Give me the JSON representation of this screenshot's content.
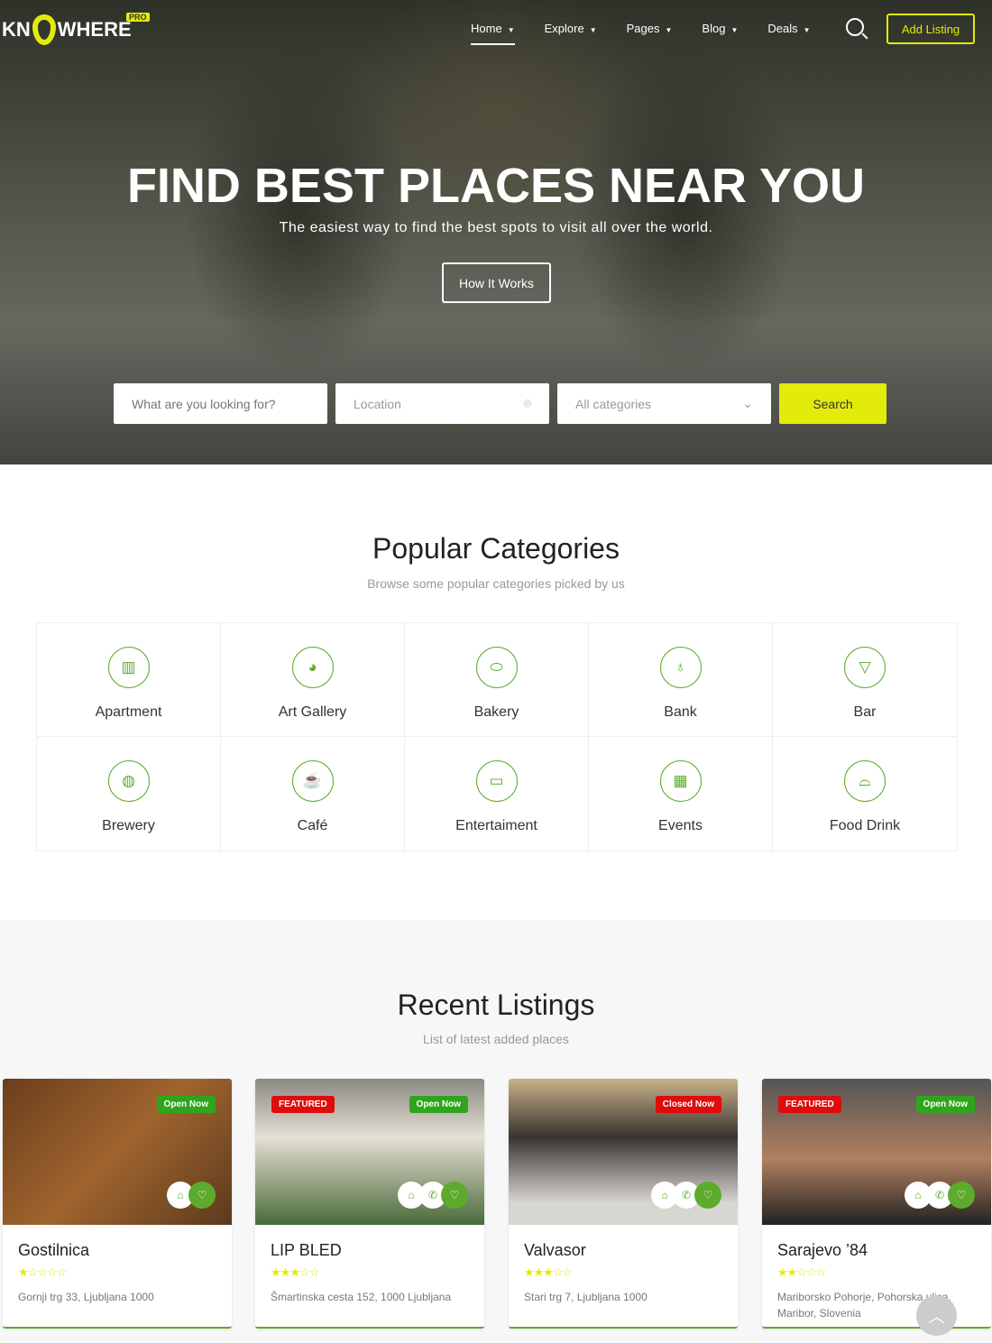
{
  "brand": {
    "logo_left": "KN",
    "logo_right": "WHERE",
    "badge": "PRO"
  },
  "nav": {
    "items": [
      {
        "label": "Home",
        "active": true
      },
      {
        "label": "Explore"
      },
      {
        "label": "Pages"
      },
      {
        "label": "Blog"
      },
      {
        "label": "Deals"
      }
    ],
    "add_listing": "Add Listing"
  },
  "hero": {
    "title": "FIND BEST PLACES NEAR YOU",
    "subtitle": "The easiest way to find the best spots to visit all over the world.",
    "cta": "How It Works"
  },
  "search": {
    "keyword_placeholder": "What are you looking for?",
    "location_placeholder": "Location",
    "category_value": "All categories",
    "button": "Search"
  },
  "categories": {
    "title": "Popular Categories",
    "subtitle": "Browse some popular categories picked by us",
    "items": [
      {
        "label": "Apartment",
        "icon": "building-icon"
      },
      {
        "label": "Art Gallery",
        "icon": "palette-icon"
      },
      {
        "label": "Bakery",
        "icon": "bread-icon"
      },
      {
        "label": "Bank",
        "icon": "money-bag-icon"
      },
      {
        "label": "Bar",
        "icon": "wine-glass-icon"
      },
      {
        "label": "Brewery",
        "icon": "beer-icon"
      },
      {
        "label": "Café",
        "icon": "coffee-icon"
      },
      {
        "label": "Entertaiment",
        "icon": "vr-glasses-icon"
      },
      {
        "label": "Events",
        "icon": "calendar-icon"
      },
      {
        "label": "Food Drink",
        "icon": "cloche-icon"
      }
    ]
  },
  "listings": {
    "title": "Recent Listings",
    "subtitle": "List of latest added places",
    "items": [
      {
        "name": "Gostilnica",
        "rating": 1,
        "address": "Gornji trg 33, Ljubljana 1000",
        "status": "Open Now",
        "featured": false
      },
      {
        "name": "LIP BLED",
        "rating": 3,
        "address": "Šmartinska cesta 152, 1000 Ljubljana",
        "status": "Open Now",
        "featured": true
      },
      {
        "name": "Valvasor",
        "rating": 3,
        "address": "Stari trg 7, Ljubljana 1000",
        "status": "Closed Now",
        "featured": false
      },
      {
        "name": "Sarajevo ’84",
        "rating": 2,
        "address": "Mariborsko Pohorje, Pohorska ulica, Maribor, Slovenia",
        "status": "Open Now",
        "featured": true
      }
    ],
    "featured_label": "FEATURED"
  },
  "colors": {
    "accent": "#e3eb0b",
    "green": "#5dab2c",
    "open": "#2ea51c",
    "closed": "#e00b0b"
  }
}
